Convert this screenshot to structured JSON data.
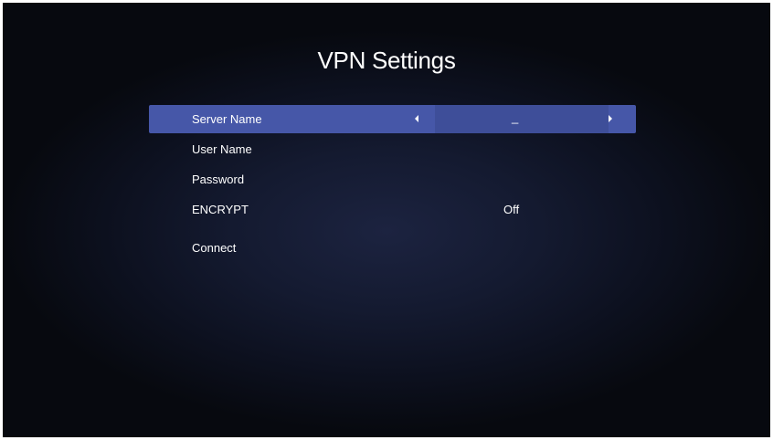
{
  "page": {
    "title": "VPN Settings"
  },
  "menu": {
    "items": [
      {
        "label": "Server Name",
        "value": "_"
      },
      {
        "label": "User Name",
        "value": ""
      },
      {
        "label": "Password",
        "value": ""
      },
      {
        "label": "ENCRYPT",
        "value": "Off"
      },
      {
        "label": "Connect",
        "value": ""
      }
    ]
  },
  "colors": {
    "highlight": "#4657a8",
    "background": "#0d1120",
    "text": "#ffffff"
  },
  "icons": {
    "prev": "arrow-left-icon",
    "next": "arrow-right-icon"
  }
}
